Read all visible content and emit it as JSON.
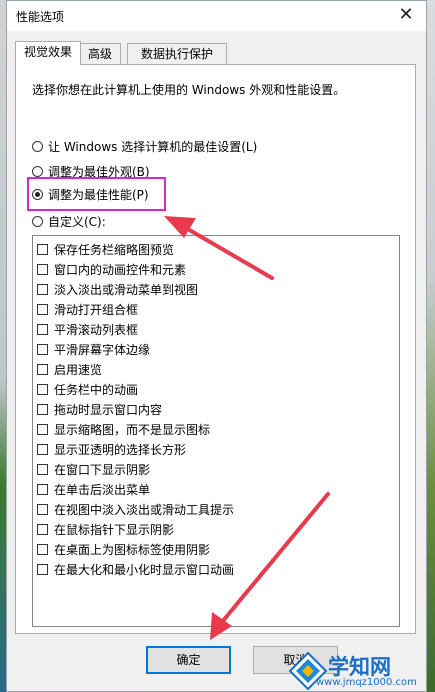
{
  "window": {
    "title": "性能选项",
    "close_label": "✕"
  },
  "tabs": [
    {
      "label": "视觉效果",
      "active": true
    },
    {
      "label": "高级",
      "active": false
    },
    {
      "label": "数据执行保护",
      "active": false
    }
  ],
  "description": "选择你想在此计算机上使用的 Windows 外观和性能设置。",
  "radios": [
    {
      "label": "让 Windows 选择计算机的最佳设置(L)",
      "checked": false
    },
    {
      "label": "调整为最佳外观(B)",
      "checked": false
    },
    {
      "label": "调整为最佳性能(P)",
      "checked": true
    },
    {
      "label": "自定义(C):",
      "checked": false
    }
  ],
  "options": [
    "保存任务栏缩略图预览",
    "窗口内的动画控件和元素",
    "淡入淡出或滑动菜单到视图",
    "滑动打开组合框",
    "平滑滚动列表框",
    "平滑屏幕字体边缘",
    "启用速览",
    "任务栏中的动画",
    "拖动时显示窗口内容",
    "显示缩略图，而不是显示图标",
    "显示亚透明的选择长方形",
    "在窗口下显示阴影",
    "在单击后淡出菜单",
    "在视图中淡入淡出或滑动工具提示",
    "在鼠标指针下显示阴影",
    "在桌面上为图标标签使用阴影",
    "在最大化和最小化时显示窗口动画"
  ],
  "buttons": {
    "ok": "确定",
    "cancel": "取消"
  },
  "watermark": {
    "text": "学知网",
    "url": "www.jmqz1000.com"
  },
  "colors": {
    "highlight": "#d129d4",
    "arrow": "#e8394d",
    "accent": "#0078d7"
  }
}
